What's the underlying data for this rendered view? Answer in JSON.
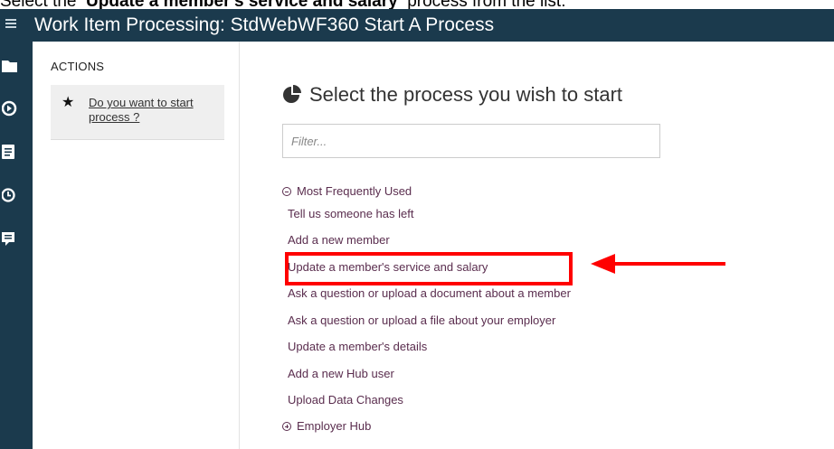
{
  "caption": {
    "prefix": "Select the ",
    "bold": "‘Update a member's service and salary’",
    "suffix": " process from the list:"
  },
  "app": {
    "title": "Work Item Processing: StdWebWF360 Start A Process",
    "menu_icon": "hamburger-icon"
  },
  "leftnav": {
    "icons": [
      "folder-icon",
      "play-circle-icon",
      "document-icon",
      "clock-icon",
      "comment-icon"
    ]
  },
  "actions": {
    "heading": "ACTIONS",
    "items": [
      {
        "icon": "star-icon",
        "label": "Do you want to start process ?"
      }
    ]
  },
  "main": {
    "heading": "Select the process you wish to start",
    "heading_icon": "pie-chart-icon",
    "filter": {
      "placeholder": "Filter...",
      "value": ""
    },
    "groups": [
      {
        "label": "Most Frequently Used",
        "expanded": true,
        "items": [
          "Tell us someone has left",
          "Add a new member",
          "Update a member's service and salary",
          "Ask a question or upload a document about a member",
          "Ask a question or upload a file about your employer",
          "Update a member's details",
          "Add a new Hub user",
          "Upload Data Changes"
        ]
      },
      {
        "label": "Employer Hub",
        "expanded": false,
        "items": []
      }
    ]
  },
  "annotation": {
    "highlight_color": "#ff0000",
    "highlighted_item": "Update a member's service and salary"
  },
  "colors": {
    "nav_bg": "#1b3a4d",
    "link": "#5a2d4e",
    "panel_bg": "#efefef"
  }
}
